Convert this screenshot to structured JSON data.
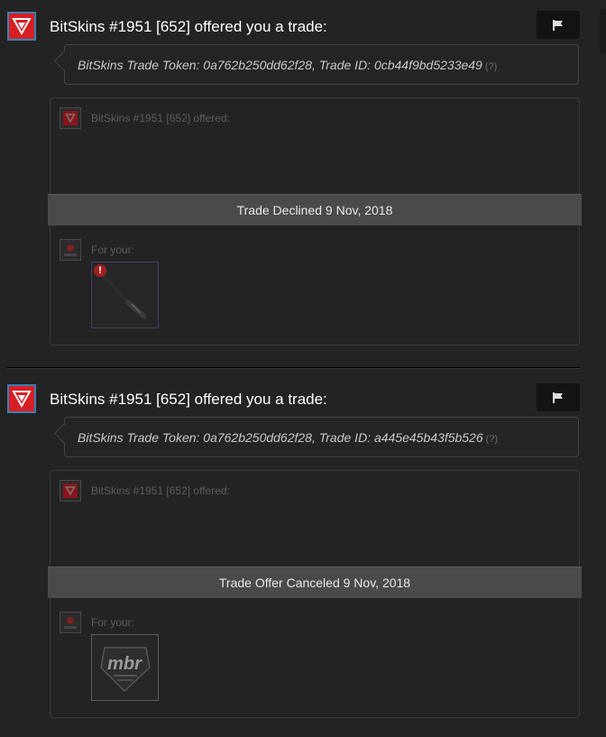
{
  "offers": [
    {
      "title": "BitSkins #1951 [652] offered you a trade:",
      "message": "BitSkins Trade Token: 0a762b250dd62f28, Trade ID: 0cb44f9bd5233e49",
      "help": "(?)",
      "offered_label": "BitSkins #1951 [652] offered:",
      "status": "Trade Declined 9 Nov, 2018",
      "for_your_label": "For your:",
      "item": {
        "icon": "knife-icon",
        "border_color": "#4b3a66",
        "warning": "!"
      }
    },
    {
      "title": "BitSkins #1951 [652] offered you a trade:",
      "message": "BitSkins Trade Token: 0a762b250dd62f28, Trade ID: a445e45b43f5b526",
      "help": "(?)",
      "offered_label": "BitSkins #1951 [652] offered:",
      "status": "Trade Offer Canceled 9 Nov, 2018",
      "for_your_label": "For your:",
      "item": {
        "icon": "mbr-sticker-icon",
        "border_color": "#5a5a5a",
        "logo_text": "mbr"
      }
    }
  ],
  "colors": {
    "avatar_bg": "#d51f25",
    "avatar_border": "#3b7fb0",
    "status_bar": "#4a4a4a",
    "page_bg": "#232323"
  }
}
